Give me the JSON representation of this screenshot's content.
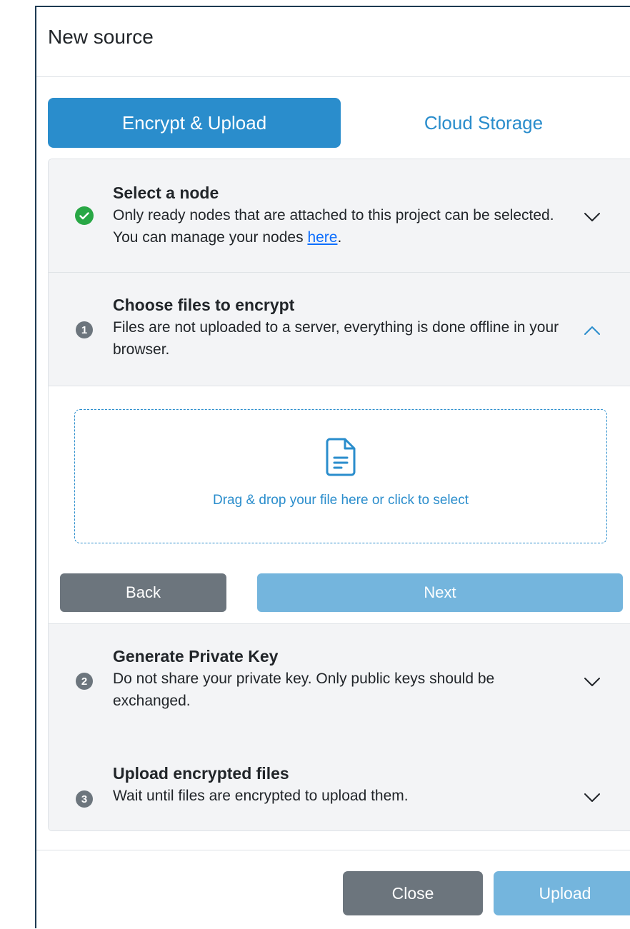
{
  "modal": {
    "title": "New source"
  },
  "tabs": [
    {
      "label": "Encrypt & Upload",
      "active": true
    },
    {
      "label": "Cloud Storage",
      "active": false
    }
  ],
  "steps": [
    {
      "status": "completed",
      "title": "Select a node",
      "desc_prefix": "Only ready nodes that are attached to this project can be selected. You can manage your nodes ",
      "link": "here",
      "desc_suffix": ".",
      "expanded": false
    },
    {
      "status": "active",
      "number": "1",
      "title": "Choose files to encrypt",
      "desc": "Files are not uploaded to a server, everything is done offline in your browser.",
      "expanded": true,
      "dropzone_text": "Drag & drop your file here or click to select",
      "back_label": "Back",
      "next_label": "Next"
    },
    {
      "status": "pending",
      "number": "2",
      "title": "Generate Private Key",
      "desc": "Do not share your private key. Only public keys should be exchanged.",
      "expanded": false
    },
    {
      "status": "pending",
      "number": "3",
      "title": "Upload encrypted files",
      "desc": "Wait until files are encrypted to upload them.",
      "expanded": false
    }
  ],
  "footer": {
    "close_label": "Close",
    "upload_label": "Upload"
  },
  "colors": {
    "primary": "#2a8dcc",
    "primary_disabled": "#74b5dd",
    "secondary": "#6c757d",
    "success": "#28a745",
    "link": "#0d6efd"
  },
  "icons": {
    "completed": "check-circle-icon",
    "collapsed": "chevron-down-icon",
    "expanded": "chevron-up-icon",
    "dropzone": "file-text-icon"
  }
}
